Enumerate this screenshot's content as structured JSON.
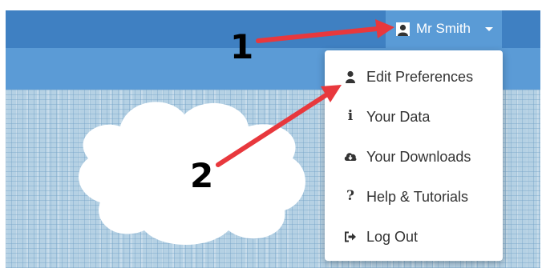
{
  "navbar": {
    "user_name": "Mr Smith",
    "user_icon": "user-silhouette-icon",
    "caret_icon": "caret-down-icon"
  },
  "user_menu": {
    "items": [
      {
        "label": "Edit Preferences",
        "icon": "user-icon"
      },
      {
        "label": "Your Data",
        "icon": "info-icon"
      },
      {
        "label": "Your Downloads",
        "icon": "cloud-download-icon"
      },
      {
        "label": "Help & Tutorials",
        "icon": "question-icon"
      },
      {
        "label": "Log Out",
        "icon": "sign-out-icon"
      }
    ]
  },
  "annotations": {
    "callout_1": "1",
    "callout_2": "2",
    "arrow_color": "#e8383d"
  },
  "colors": {
    "navbar": "#3f80c2",
    "subbar": "#5b9bd6",
    "active_toggle": "#5a9bd6",
    "background": "#b5d1e4"
  }
}
